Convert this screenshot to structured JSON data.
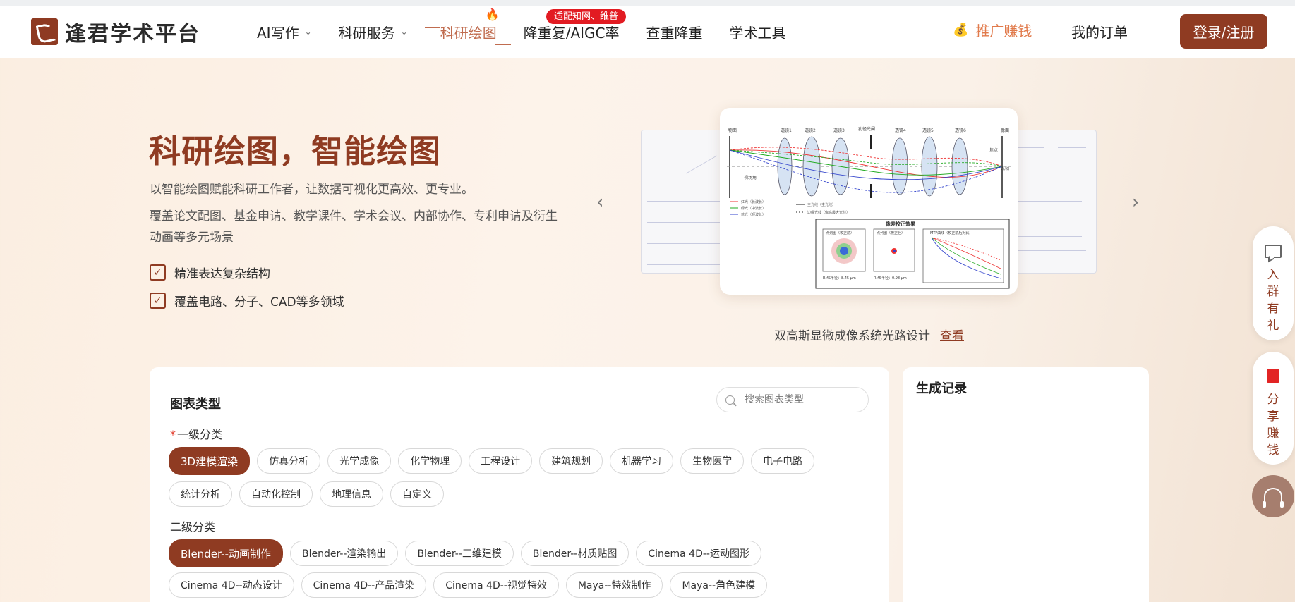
{
  "header": {
    "logo_text": "逢君学术平台",
    "nav": [
      {
        "label": "AI写作"
      },
      {
        "label": "科研服务"
      },
      {
        "label": "科研绘图"
      },
      {
        "label": "降重复/AIGC率"
      },
      {
        "label": "查重降重"
      },
      {
        "label": "学术工具"
      }
    ],
    "badge": "适配知网、维普",
    "promo_label": "推广赚钱",
    "orders_label": "我的订单",
    "login_label": "登录/注册"
  },
  "hero": {
    "title": "科研绘图，智能绘图",
    "desc1": "以智能绘图赋能科研工作者，让数据可视化更高效、更专业。",
    "desc2": "覆盖论文配图、基金申请、教学课件、学术会议、内部协作、专利申请及衍生动画等多元场景",
    "features": [
      "精准表达复杂结构",
      "覆盖电路、分子、CAD等多领域"
    ]
  },
  "carousel": {
    "prev": "‹",
    "next": "›",
    "caption": "双高斯显微成像系统光路设计",
    "caption_link": "查看",
    "diagram": {
      "top_labels": [
        "物面",
        "透镜1",
        "透镜2",
        "透镜3",
        "孔径光阑",
        "透镜4",
        "透镜5",
        "透镜6",
        "像面"
      ],
      "side_labels": [
        "视场角",
        "焦点",
        "光轴"
      ],
      "legend": [
        "红光（长波长）",
        "绿光（中波长）",
        "蓝光（短波长）",
        "主光线（主光线）",
        "边缘光线（像高最大光线）"
      ],
      "sub_title": "像差校正效果",
      "box_labels": [
        "点列图（校正前）",
        "点列图（校正后）",
        "MTF曲线（校正前后对比）"
      ],
      "rms_labels": [
        "RMS半径：8.45 μm",
        "RMS半径：0.98 μm"
      ]
    }
  },
  "panel": {
    "title": "图表类型",
    "search_placeholder": "搜索图表类型",
    "level1_label": "一级分类",
    "level1_required": "*",
    "level1_row1": [
      "3D建模渲染",
      "仿真分析",
      "光学成像",
      "化学物理",
      "工程设计",
      "建筑规划",
      "机器学习",
      "生物医学",
      "电子电路"
    ],
    "level1_row2": [
      "统计分析",
      "自动化控制",
      "地理信息",
      "自定义"
    ],
    "level2_label": "二级分类",
    "level2_row1": [
      "Blender--动画制作",
      "Blender--渲染输出",
      "Blender--三维建模",
      "Blender--材质贴图",
      "Cinema 4D--运动图形"
    ],
    "level2_row2": [
      "Cinema 4D--动态设计",
      "Cinema 4D--产品渲染",
      "Cinema 4D--视觉特效",
      "Maya--特效制作",
      "Maya--角色建模"
    ]
  },
  "history": {
    "title": "生成记录"
  },
  "floating": {
    "group_text": "入群有礼",
    "share_text": "分享赚钱"
  },
  "colors": {
    "brand": "#8f3b22",
    "accent_orange": "#e17a4b",
    "badge_red": "#e21b22"
  },
  "icons": [
    "logo-icon",
    "fire-icon",
    "money-bag-icon",
    "checkbox-icon",
    "search-icon",
    "chat-icon",
    "share-icon",
    "headset-icon"
  ]
}
